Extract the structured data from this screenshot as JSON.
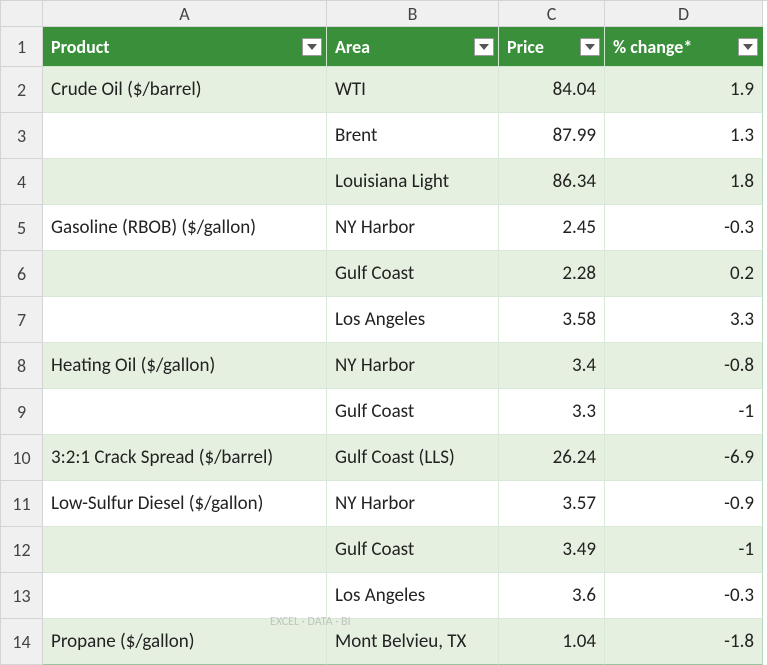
{
  "columns": {
    "letters": [
      "A",
      "B",
      "C",
      "D"
    ],
    "headers": [
      "Product",
      "Area",
      "Price",
      "% change*"
    ]
  },
  "rows": [
    {
      "n": "2",
      "product": "Crude Oil ($/barrel)",
      "area": "WTI",
      "price": "84.04",
      "change": "1.9"
    },
    {
      "n": "3",
      "product": "",
      "area": "Brent",
      "price": "87.99",
      "change": "1.3"
    },
    {
      "n": "4",
      "product": "",
      "area": "Louisiana Light",
      "price": "86.34",
      "change": "1.8"
    },
    {
      "n": "5",
      "product": "Gasoline (RBOB) ($/gallon)",
      "area": "NY Harbor",
      "price": "2.45",
      "change": "-0.3"
    },
    {
      "n": "6",
      "product": "",
      "area": "Gulf Coast",
      "price": "2.28",
      "change": "0.2"
    },
    {
      "n": "7",
      "product": "",
      "area": "Los Angeles",
      "price": "3.58",
      "change": "3.3"
    },
    {
      "n": "8",
      "product": "Heating Oil ($/gallon)",
      "area": "NY Harbor",
      "price": "3.4",
      "change": "-0.8"
    },
    {
      "n": "9",
      "product": "",
      "area": "Gulf Coast",
      "price": "3.3",
      "change": "-1"
    },
    {
      "n": "10",
      "product": "3:2:1 Crack Spread ($/barrel)",
      "area": "Gulf Coast (LLS)",
      "price": "26.24",
      "change": "-6.9"
    },
    {
      "n": "11",
      "product": "Low-Sulfur Diesel ($/gallon)",
      "area": "NY Harbor",
      "price": "3.57",
      "change": "-0.9"
    },
    {
      "n": "12",
      "product": "",
      "area": "Gulf Coast",
      "price": "3.49",
      "change": "-1"
    },
    {
      "n": "13",
      "product": "",
      "area": "Los Angeles",
      "price": "3.6",
      "change": "-0.3"
    },
    {
      "n": "14",
      "product": "Propane ($/gallon)",
      "area": "Mont Belvieu, TX",
      "price": "1.04",
      "change": "-1.8"
    }
  ],
  "watermark": "EXCEL · DATA · BI",
  "chart_data": {
    "type": "table",
    "title": "",
    "columns": [
      "Product",
      "Area",
      "Price",
      "% change*"
    ],
    "data": [
      [
        "Crude Oil ($/barrel)",
        "WTI",
        84.04,
        1.9
      ],
      [
        "Crude Oil ($/barrel)",
        "Brent",
        87.99,
        1.3
      ],
      [
        "Crude Oil ($/barrel)",
        "Louisiana Light",
        86.34,
        1.8
      ],
      [
        "Gasoline (RBOB) ($/gallon)",
        "NY Harbor",
        2.45,
        -0.3
      ],
      [
        "Gasoline (RBOB) ($/gallon)",
        "Gulf Coast",
        2.28,
        0.2
      ],
      [
        "Gasoline (RBOB) ($/gallon)",
        "Los Angeles",
        3.58,
        3.3
      ],
      [
        "Heating Oil ($/gallon)",
        "NY Harbor",
        3.4,
        -0.8
      ],
      [
        "Heating Oil ($/gallon)",
        "Gulf Coast",
        3.3,
        -1
      ],
      [
        "3:2:1 Crack Spread ($/barrel)",
        "Gulf Coast (LLS)",
        26.24,
        -6.9
      ],
      [
        "Low-Sulfur Diesel ($/gallon)",
        "NY Harbor",
        3.57,
        -0.9
      ],
      [
        "Low-Sulfur Diesel ($/gallon)",
        "Gulf Coast",
        3.49,
        -1
      ],
      [
        "Low-Sulfur Diesel ($/gallon)",
        "Los Angeles",
        3.6,
        -0.3
      ],
      [
        "Propane ($/gallon)",
        "Mont Belvieu, TX",
        1.04,
        -1.8
      ]
    ]
  }
}
